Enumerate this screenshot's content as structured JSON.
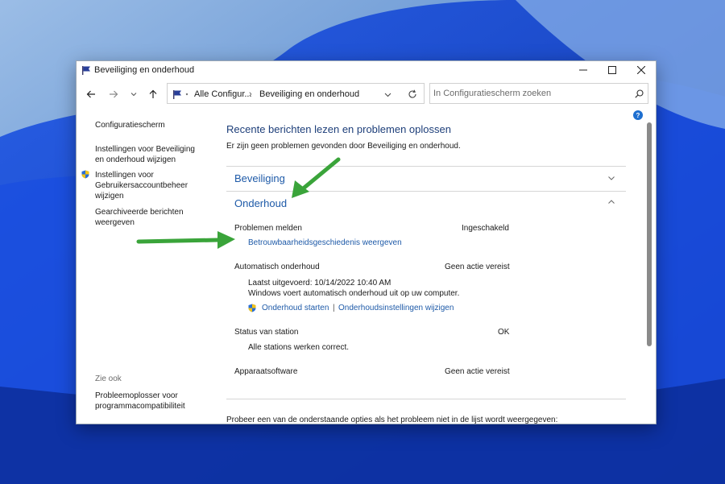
{
  "window": {
    "title": "Beveiliging en onderhoud"
  },
  "address": {
    "crumbs": [
      "Alle Configur...",
      "Beveiliging en onderhoud"
    ],
    "separator": "›"
  },
  "search": {
    "placeholder": "In Configuratiescherm zoeken"
  },
  "sidebar": {
    "items": [
      {
        "label": "Configuratiescherm"
      },
      {
        "label": "Instellingen voor Beveiliging\nen onderhoud wijzigen"
      },
      {
        "label": "Instellingen voor\nGebruikersaccountbeheer\nwijzigen"
      },
      {
        "label": "Gearchiveerde berichten\nweergeven"
      }
    ],
    "see_also": "Zie ook",
    "see_also_items": [
      {
        "label": "Probleemoplosser voor\nprogrammacompatibiliteit"
      }
    ]
  },
  "main": {
    "heading": "Recente berichten lezen en problemen oplossen",
    "subtext": "Er zijn geen problemen gevonden door Beveiliging en onderhoud.",
    "sections": {
      "security": {
        "title": "Beveiliging"
      },
      "maintenance": {
        "title": "Onderhoud",
        "rows": {
          "problem_reporting": {
            "label": "Problemen melden",
            "value": "Ingeschakeld",
            "link": "Betrouwbaarheidsgeschiedenis weergeven"
          },
          "auto_maintenance": {
            "label": "Automatisch onderhoud",
            "value": "Geen actie vereist",
            "last_run": "Laatst uitgevoerd: 10/14/2022 10:40 AM",
            "description": "Windows voert automatisch onderhoud uit op uw computer.",
            "start_link": "Onderhoud starten",
            "divider": "|",
            "settings_link": "Onderhoudsinstellingen wijzigen"
          },
          "drive_status": {
            "label": "Status van station",
            "value": "OK",
            "detail": "Alle stations werken correct."
          },
          "device_software": {
            "label": "Apparaatsoftware",
            "value": "Geen actie vereist"
          }
        }
      }
    },
    "footer_text": "Probeer een van de onderstaande opties als het probleem niet in de lijst wordt weergegeven:"
  },
  "colors": {
    "accent": "#1e5aa8",
    "heading": "#1e3f7a",
    "annotation_arrow": "#3aa43a"
  }
}
